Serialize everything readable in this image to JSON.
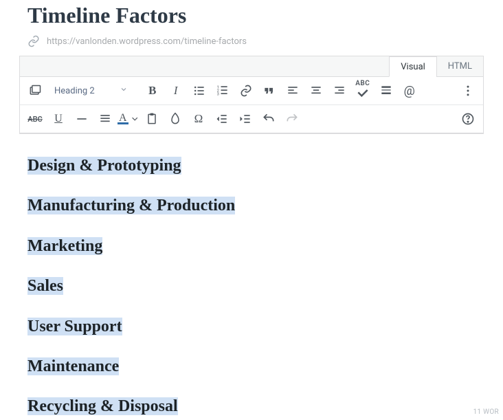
{
  "title": "Timeline Factors",
  "permalink": "https://vanlonden.wordpress.com/timeline-factors",
  "tabs": {
    "visual": "Visual",
    "html": "HTML"
  },
  "format_dropdown": "Heading 2",
  "toolbar_row2_abc": "ABC",
  "content": {
    "h0": "Design & Prototyping",
    "h1": "Manufacturing & Production",
    "h2": "Marketing",
    "h3": "Sales",
    "h4": "User Support",
    "h5": "Maintenance",
    "h6": "Recycling & Disposal"
  },
  "wordcount_partial": "11 WOR"
}
